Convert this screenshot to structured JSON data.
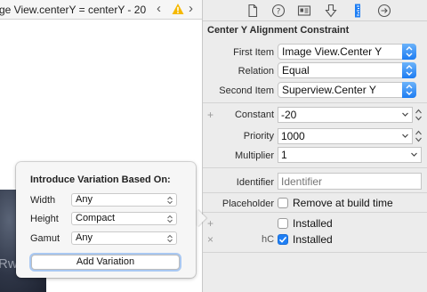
{
  "jump_bar": {
    "path": "ge View.centerY = centerY - 20",
    "back_arrow": "‹",
    "forward_arrow": "›",
    "warning_icon": "warning-icon"
  },
  "canvas": {
    "image_view_label": "Rw"
  },
  "inspector": {
    "tabs": [
      "file-icon",
      "help-icon",
      "identity-icon",
      "attributes-icon",
      "size-icon",
      "connections-icon"
    ],
    "section_title": "Center Y Alignment Constraint",
    "first_item": {
      "label": "First Item",
      "value": "Image View.Center Y"
    },
    "relation": {
      "label": "Relation",
      "value": "Equal"
    },
    "second_item": {
      "label": "Second Item",
      "value": "Superview.Center Y"
    },
    "constant": {
      "label": "Constant",
      "value": "-20",
      "add_symbol": "+"
    },
    "priority": {
      "label": "Priority",
      "value": "1000"
    },
    "multiplier": {
      "label": "Multiplier",
      "value": "1"
    },
    "identifier": {
      "label": "Identifier",
      "placeholder": "Identifier"
    },
    "placeholder": {
      "label": "Placeholder",
      "checkbox_label": "Remove at build time",
      "checked": false
    },
    "installed_rows": [
      {
        "prefix": "+",
        "size_class": "",
        "label": "Installed",
        "checked": false
      },
      {
        "prefix": "×",
        "size_class": "hC",
        "label": "Installed",
        "checked": true
      }
    ]
  },
  "variation_popover": {
    "title": "Introduce Variation Based On:",
    "rows": [
      {
        "label": "Width",
        "value": "Any"
      },
      {
        "label": "Height",
        "value": "Compact"
      },
      {
        "label": "Gamut",
        "value": "Any"
      }
    ],
    "add_button": "Add Variation"
  },
  "colors": {
    "accent": "#1e7ef4",
    "warning": "#f5b800"
  }
}
